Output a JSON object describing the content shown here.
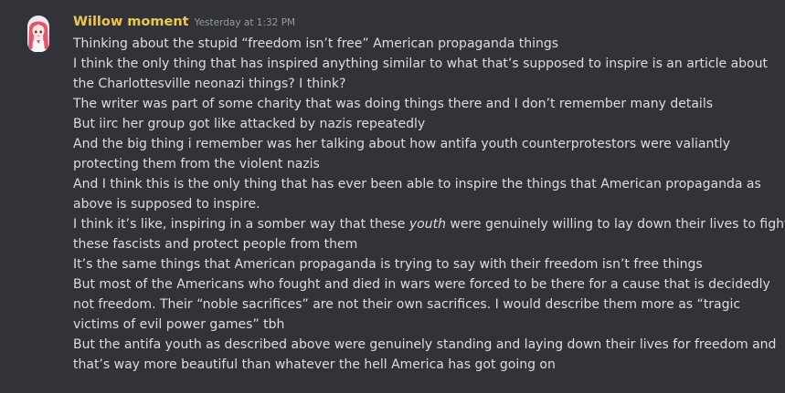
{
  "message": {
    "username": "Willow moment",
    "timestamp": "Yesterday at 1:32 PM",
    "lines": [
      "Thinking about the stupid “freedom isn’t free” American propaganda things",
      "I think the only thing that has inspired anything similar to what that’s supposed to inspire is an article about",
      "the Charlottesville neonazi things? I think?",
      "The writer was part of some charity that was doing things there and I don’t remember many details",
      "But iirc her group got like attacked by nazis repeatedly",
      "And the big thing i remember was her talking about how antifa youth counterprotestors were valiantly",
      "protecting them from the violent nazis",
      "And I think this is the only thing that has ever been able to inspire the things that American propaganda as",
      "above is supposed to inspire.",
      "I think it’s like, inspiring in a somber way that these",
      "these fascists and protect people from them",
      "It’s the same things that American propaganda is trying to say with their freedom isn’t free things",
      "But most of the Americans who fought and died in wars were forced to be there for a cause that is decidedly",
      "not freedom. Their “noble sacrifices” are not their own sacrifices. I would describe them more as “tragic",
      "victims of evil power games” tbh",
      "But the antifa youth as described above were genuinely standing and laying down their lives for freedom and",
      "that’s way more beautiful than whatever the hell America has got going on"
    ],
    "line10_italic": "youth",
    "line10_after": "were genuinely willing to lay down their lives to fight"
  },
  "colors": {
    "background": "#313338",
    "username": "#f0c74a",
    "text": "#dbdee1",
    "timestamp": "#949ba4"
  },
  "icons": {
    "avatar": "pink-haired-anime-avatar"
  }
}
